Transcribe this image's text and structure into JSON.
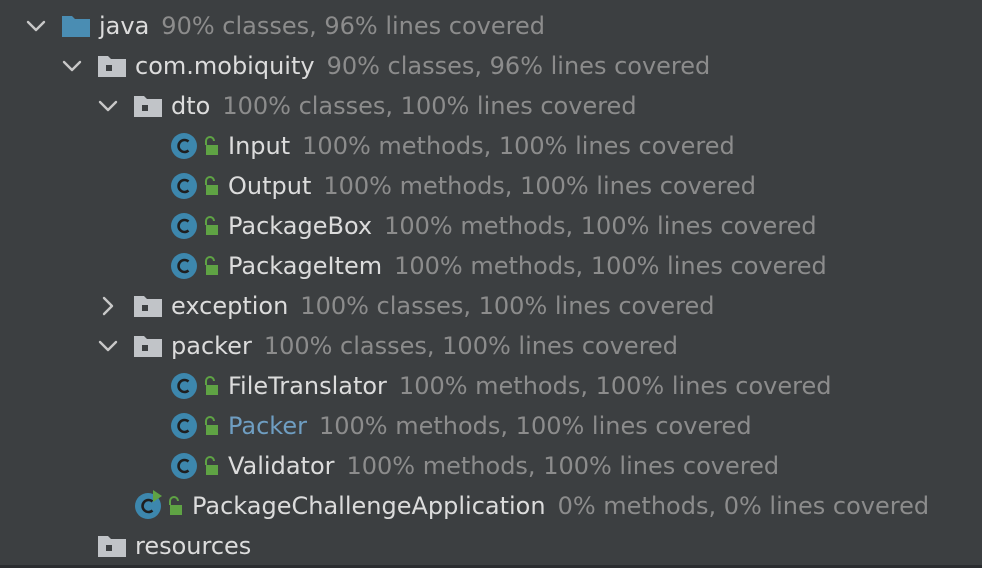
{
  "colors": {
    "background": "#3c3f41",
    "text": "#dcdcdc",
    "coverage_text": "#8c8c8c",
    "link_text": "#6f9ec2",
    "class_icon": "#3d87ad",
    "lock_icon": "#5fa344",
    "folder_icon": "#c1c4c8",
    "source_root_icon": "#4a8db3"
  },
  "tree": {
    "java": {
      "name": "java",
      "coverage": "90% classes, 96% lines covered",
      "icon": "source-root-folder-icon"
    },
    "com_mobiquity": {
      "name": "com.mobiquity",
      "coverage": "90% classes, 96% lines covered",
      "icon": "package-folder-icon"
    },
    "dto": {
      "name": "dto",
      "coverage": "100% classes, 100% lines covered",
      "icon": "package-folder-icon"
    },
    "input": {
      "name": "Input",
      "coverage": "100% methods, 100% lines covered",
      "icon": "class-icon"
    },
    "output": {
      "name": "Output",
      "coverage": "100% methods, 100% lines covered",
      "icon": "class-icon"
    },
    "package_box": {
      "name": "PackageBox",
      "coverage": "100% methods, 100% lines covered",
      "icon": "class-icon"
    },
    "package_item": {
      "name": "PackageItem",
      "coverage": "100% methods, 100% lines covered",
      "icon": "class-icon"
    },
    "exception": {
      "name": "exception",
      "coverage": "100% classes, 100% lines covered",
      "icon": "package-folder-icon"
    },
    "packer_pkg": {
      "name": "packer",
      "coverage": "100% classes, 100% lines covered",
      "icon": "package-folder-icon"
    },
    "file_translator": {
      "name": "FileTranslator",
      "coverage": "100% methods, 100% lines covered",
      "icon": "class-icon"
    },
    "packer_class": {
      "name": "Packer",
      "coverage": "100% methods, 100% lines covered",
      "icon": "class-icon"
    },
    "validator": {
      "name": "Validator",
      "coverage": "100% methods, 100% lines covered",
      "icon": "class-icon"
    },
    "app": {
      "name": "PackageChallengeApplication",
      "coverage": "0% methods, 0% lines covered",
      "icon": "runnable-class-icon"
    },
    "resources": {
      "name": "resources",
      "coverage": "",
      "icon": "resources-folder-icon"
    }
  }
}
